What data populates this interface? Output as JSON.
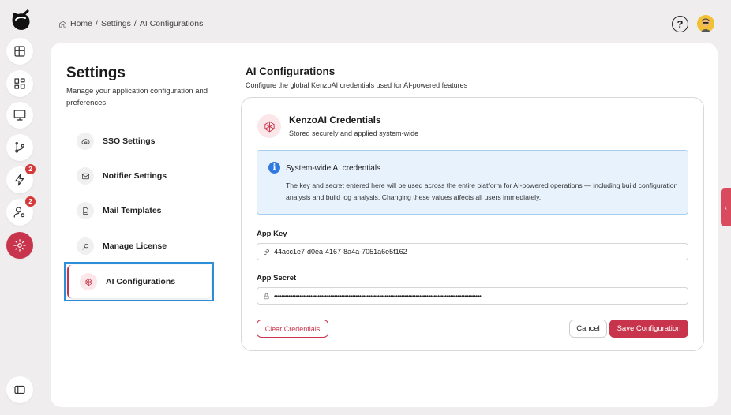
{
  "breadcrumb": {
    "home": "Home",
    "sep1": "/",
    "settings": "Settings",
    "sep2": "/",
    "current": "AI Configurations"
  },
  "header": {
    "help_icon": "question-circle-icon",
    "help_label": "?"
  },
  "rail": {
    "items": [
      {
        "icon": "layout-grid-icon"
      },
      {
        "icon": "dashboard-icon"
      },
      {
        "icon": "monitor-icon"
      },
      {
        "icon": "git-branch-icon"
      },
      {
        "icon": "lightning-icon",
        "badge": "2"
      },
      {
        "icon": "user-settings-icon",
        "badge": "2"
      },
      {
        "icon": "gear-icon",
        "active": true
      },
      {
        "icon": "sidebar-toggle-icon"
      }
    ]
  },
  "settings": {
    "title": "Settings",
    "description": "Manage your application configuration and preferences",
    "nav": [
      {
        "label": "SSO Settings",
        "icon": "cloud-lock-icon"
      },
      {
        "label": "Notifier Settings",
        "icon": "mail-icon"
      },
      {
        "label": "Mail Templates",
        "icon": "document-icon"
      },
      {
        "label": "Manage License",
        "icon": "search-key-icon"
      },
      {
        "label": "AI Configurations",
        "icon": "ai-sparkle-icon",
        "active": true
      }
    ]
  },
  "content": {
    "title": "AI Configurations",
    "subtitle": "Configure the global KenzoAI credentials used for AI-powered features",
    "card": {
      "title": "KenzoAI Credentials",
      "subtitle": "Stored securely and applied system-wide",
      "info": {
        "title": "System-wide AI credentials",
        "text": "The key and secret entered here will be used across the entire platform for AI-powered operations — including build configuration analysis and build log analysis. Changing these values affects all users immediately."
      },
      "app_key": {
        "label": "App Key",
        "value": "44acc1e7-d0ea-4167-8a4a-7051a6e5f162"
      },
      "app_secret": {
        "label": "App Secret",
        "value": "••••••••••••••••••••••••••••••••••••••••••••••••••••••••••••••••••••••••••••••••••••••••••••••••••••••••••••••••••"
      },
      "clear_label": "Clear Credentials",
      "cancel_label": "Cancel",
      "save_label": "Save Configuration"
    }
  },
  "colors": {
    "accent": "#c8344b",
    "info_bg": "#e8f2fc",
    "info_border": "#a9cdef",
    "focus": "#2d8fd8"
  }
}
